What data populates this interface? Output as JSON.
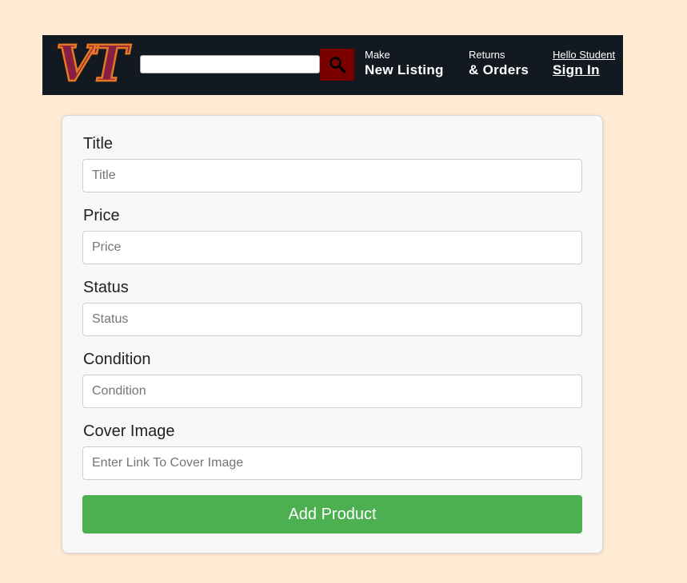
{
  "colors": {
    "page_background": "#ffebd4",
    "navbar_background": "#131921",
    "search_button": "#7a0000",
    "logo_maroon": "#861f41",
    "logo_orange": "#e87722",
    "submit_button": "#4caf50"
  },
  "navbar": {
    "logo_text": "VT",
    "search": {
      "value": "",
      "placeholder": "",
      "icon": "search-icon"
    },
    "links": [
      {
        "small": "Make",
        "big": "New Listing"
      },
      {
        "small": "Returns",
        "big": "& Orders"
      },
      {
        "small": "Hello Student",
        "big": "Sign In"
      }
    ]
  },
  "form": {
    "fields": [
      {
        "label": "Title",
        "placeholder": "Title",
        "value": ""
      },
      {
        "label": "Price",
        "placeholder": "Price",
        "value": ""
      },
      {
        "label": "Status",
        "placeholder": "Status",
        "value": ""
      },
      {
        "label": "Condition",
        "placeholder": "Condition",
        "value": ""
      },
      {
        "label": "Cover Image",
        "placeholder": "Enter Link To Cover Image",
        "value": ""
      }
    ],
    "submit_label": "Add Product"
  }
}
